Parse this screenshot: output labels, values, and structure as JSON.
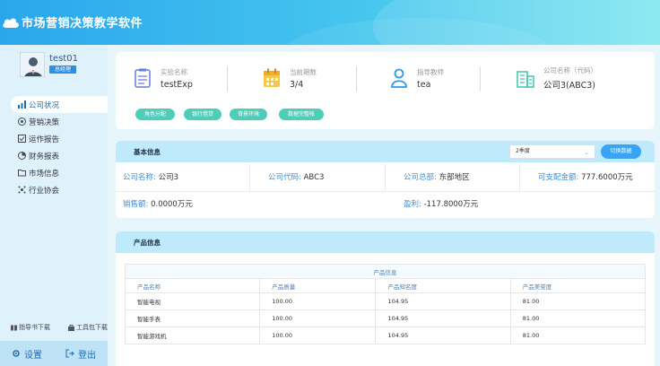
{
  "app": {
    "title": "市场营销决策教学软件"
  },
  "user": {
    "name": "test01",
    "role": "总经理"
  },
  "menu": [
    {
      "label": "公司状况",
      "icon": "chart-bar-icon",
      "active": true
    },
    {
      "label": "营销决策",
      "icon": "target-icon",
      "active": false
    },
    {
      "label": "运作报告",
      "icon": "checklist-icon",
      "active": false
    },
    {
      "label": "财务报表",
      "icon": "pie-chart-icon",
      "active": false
    },
    {
      "label": "市场信息",
      "icon": "folder-icon",
      "active": false
    },
    {
      "label": "行业协会",
      "icon": "network-icon",
      "active": false
    }
  ],
  "downloads": {
    "guide": "指导书下载",
    "tools": "工具包下载"
  },
  "footer": {
    "settings": "设置",
    "logout": "登出"
  },
  "experiment": {
    "name_label": "实验名称",
    "name_value": "testExp",
    "period_label": "当前期数",
    "period_value": "3/4",
    "teacher_label": "指导教师",
    "teacher_value": "tea",
    "company_label": "公司名称（代码）",
    "company_value": "公司3(ABC3)"
  },
  "actions": [
    "角色分配",
    "银行借贷",
    "背景环境",
    "数据完整帐"
  ],
  "basic": {
    "title": "基本信息",
    "quarter_select": "2季度",
    "switch_button": "切换数据",
    "company_name_label": "公司名称:",
    "company_name": "公司3",
    "company_code_label": "公司代码:",
    "company_code": "ABC3",
    "hq_label": "公司总部:",
    "hq": "东部地区",
    "funds_label": "可支配金额:",
    "funds": "777.6000万元",
    "sales_label": "销售额:",
    "sales": "0.0000万元",
    "profit_label": "盈利:",
    "profit": "-117.8000万元"
  },
  "product": {
    "title": "产品信息",
    "table_caption": "产品信息",
    "headers": [
      "产品名称",
      "产品质量",
      "产品知名度",
      "产品美誉度"
    ],
    "rows": [
      [
        "智能电视",
        "100.00",
        "104.95",
        "81.00"
      ],
      [
        "智能手表",
        "100.00",
        "104.95",
        "81.00"
      ],
      [
        "智能游戏机",
        "100.00",
        "104.95",
        "81.00"
      ]
    ]
  }
}
